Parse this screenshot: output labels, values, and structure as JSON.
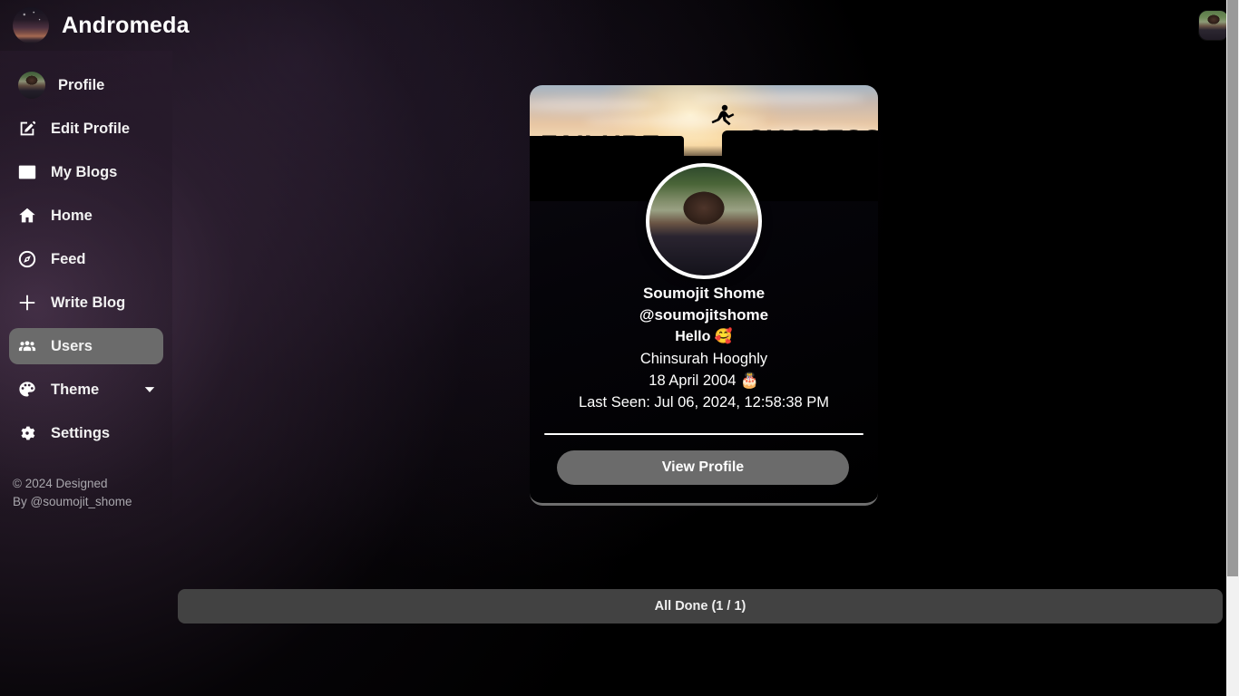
{
  "app": {
    "title": "Andromeda",
    "logo_icon": "galaxy-logo",
    "topbar_avatar_icon": "user-avatar-thumbnail"
  },
  "sidebar": {
    "items": [
      {
        "label": "Profile",
        "icon": "user-avatar-icon",
        "active": false
      },
      {
        "label": "Edit Profile",
        "icon": "pencil-square-icon",
        "active": false
      },
      {
        "label": "My Blogs",
        "icon": "image-icon",
        "active": false
      },
      {
        "label": "Home",
        "icon": "home-icon",
        "active": false
      },
      {
        "label": "Feed",
        "icon": "compass-icon",
        "active": false
      },
      {
        "label": "Write Blog",
        "icon": "plus-icon",
        "active": false
      },
      {
        "label": "Users",
        "icon": "people-group-icon",
        "active": true
      },
      {
        "label": "Theme",
        "icon": "palette-icon",
        "active": false,
        "chevron": "chevron-down-icon"
      },
      {
        "label": "Settings",
        "icon": "gear-icon",
        "active": false
      }
    ],
    "copyright_line1": "© 2024 Designed",
    "copyright_line2": "By @soumojit_shome"
  },
  "profile_card": {
    "banner": {
      "left_word": "FAILURE",
      "right_word": "SUCCESS",
      "figure_icon": "jumping-person-silhouette"
    },
    "avatar_icon": "profile-photo",
    "name": "Soumojit Shome",
    "handle": "@soumojitshome",
    "bio": "Hello 🥰",
    "location": "Chinsurah Hooghly",
    "birthday": "18 April 2004 🎂",
    "last_seen": "Last Seen: Jul 06, 2024, 12:58:38 PM",
    "view_profile_label": "View Profile"
  },
  "footer": {
    "all_done_label": "All Done (1 / 1)"
  },
  "colors": {
    "accent_gray": "#6b6b6b",
    "bar_gray": "#424242",
    "background_purple": "#3a283e",
    "background_black": "#000000",
    "text_primary": "#ffffff",
    "text_muted": "#a9a7ad",
    "scrollbar_thumb": "#9a9a9a",
    "scrollbar_track": "#f1f1f1"
  }
}
